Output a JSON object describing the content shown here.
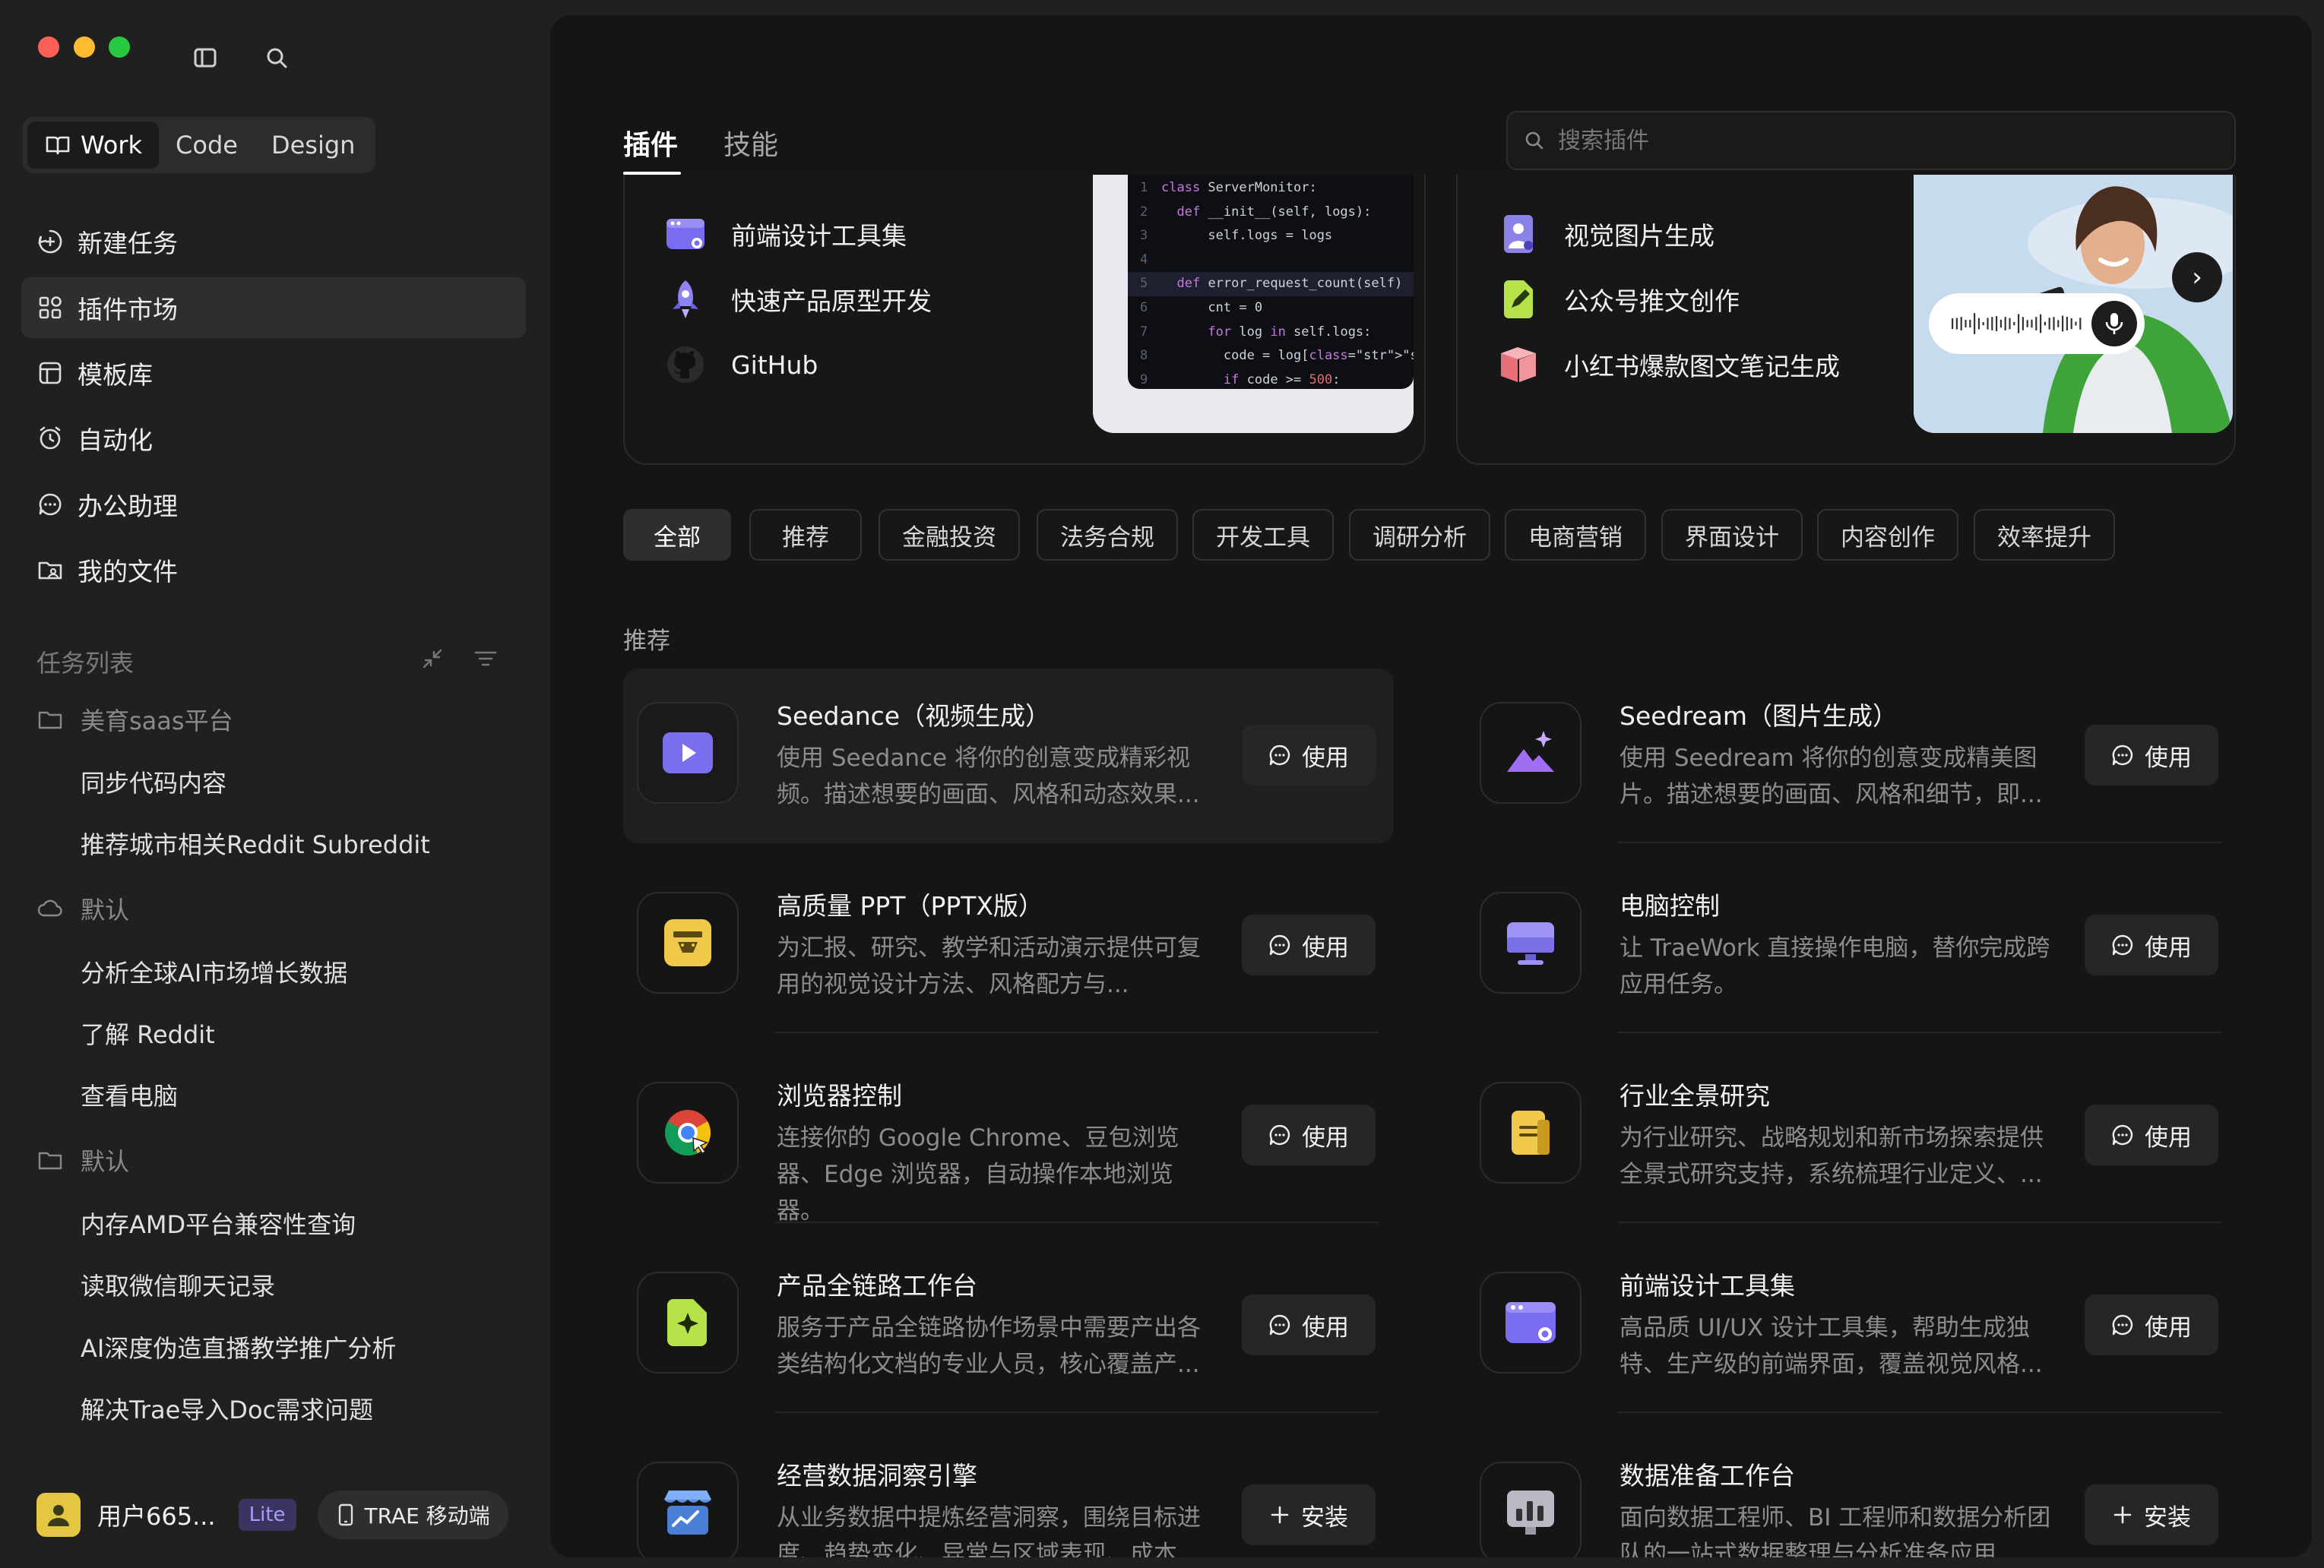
{
  "window": {
    "controls": [
      "close",
      "minimize",
      "maximize"
    ]
  },
  "sidebar": {
    "toggle_icon": "sidebar-toggle-icon",
    "search_icon": "search-icon",
    "modes": [
      {
        "label": "Work",
        "icon": "book-icon",
        "active": true
      },
      {
        "label": "Code",
        "active": false
      },
      {
        "label": "Design",
        "active": false
      }
    ],
    "nav": [
      {
        "label": "新建任务",
        "icon": "plus-circle-icon"
      },
      {
        "label": "插件市场",
        "icon": "plugin-grid-icon",
        "active": true
      },
      {
        "label": "模板库",
        "icon": "template-icon"
      },
      {
        "label": "自动化",
        "icon": "clock-icon"
      },
      {
        "label": "办公助理",
        "icon": "chat-icon"
      },
      {
        "label": "我的文件",
        "icon": "folder-user-icon"
      }
    ],
    "tasks_header": "任务列表",
    "groups": [
      {
        "name": "美育saas平台",
        "icon": "folder-icon",
        "tasks": [
          "同步代码内容",
          "推荐城市相关Reddit Subreddit"
        ]
      },
      {
        "name": "默认",
        "icon": "cloud-icon",
        "tasks": [
          "分析全球AI市场增长数据",
          "了解 Reddit",
          "查看电脑"
        ]
      },
      {
        "name": "默认",
        "icon": "folder-icon",
        "tasks": [
          "内存AMD平台兼容性查询",
          "读取微信聊天记录",
          "AI深度伪造直播教学推广分析",
          "解决Trae导入Doc需求问题"
        ]
      }
    ],
    "user": {
      "name": "用户665...",
      "plan": "Lite",
      "mobile_label": "TRAE 移动端"
    }
  },
  "main": {
    "tabs": [
      {
        "label": "插件",
        "active": true
      },
      {
        "label": "技能",
        "active": false
      }
    ],
    "search": {
      "placeholder": "搜索插件",
      "value": ""
    },
    "banner_left": {
      "items": [
        {
          "label": "前端设计工具集",
          "icon": "browser-window-icon"
        },
        {
          "label": "快速产品原型开发",
          "icon": "rocket-icon"
        },
        {
          "label": "GitHub",
          "icon": "github-icon"
        }
      ],
      "code_lines": [
        {
          "n": "1",
          "text": "class ServerMonitor:"
        },
        {
          "n": "2",
          "text": "  def __init__(self, logs):"
        },
        {
          "n": "3",
          "text": "      self.logs = logs"
        },
        {
          "n": "4",
          "text": ""
        },
        {
          "n": "5",
          "text": "  def error_request_count(self)"
        },
        {
          "n": "6",
          "text": "      cnt = 0"
        },
        {
          "n": "7",
          "text": "      for log in self.logs:"
        },
        {
          "n": "8",
          "text": "        code = log[\"status_cod"
        },
        {
          "n": "9",
          "text": "        if code >= 500:"
        }
      ]
    },
    "banner_right": {
      "items": [
        {
          "label": "视觉图片生成",
          "icon": "image-gen-icon"
        },
        {
          "label": "公众号推文创作",
          "icon": "document-edit-icon"
        },
        {
          "label": "小红书爆款图文笔记生成",
          "icon": "open-book-icon"
        }
      ]
    },
    "chips": [
      "全部",
      "推荐",
      "金融投资",
      "法务合规",
      "开发工具",
      "调研分析",
      "电商营销",
      "界面设计",
      "内容创作",
      "效率提升"
    ],
    "active_chip": "全部",
    "section_title": "推荐",
    "plugins": [
      {
        "title": "Seedance（视频生成）",
        "desc": "使用 Seedance 将你的创意变成精彩视频。描述想要的画面、风格和动态效果...",
        "action": "使用",
        "icon": "video-play-icon"
      },
      {
        "title": "Seedream（图片生成）",
        "desc": "使用 Seedream 将你的创意变成精美图片。描述想要的画面、风格和细节，即...",
        "action": "使用",
        "icon": "mountain-image-icon"
      },
      {
        "title": "高质量 PPT（PPTX版）",
        "desc": "为汇报、研究、教学和活动演示提供可复用的视觉设计方法、风格配方与...",
        "action": "使用",
        "icon": "presentation-icon"
      },
      {
        "title": "电脑控制",
        "desc": "让 TraeWork 直接操作电脑，替你完成跨应用任务。",
        "action": "使用",
        "icon": "monitor-icon"
      },
      {
        "title": "浏览器控制",
        "desc": "连接你的 Google Chrome、豆包浏览器、Edge 浏览器，自动操作本地浏览器。",
        "action": "使用",
        "icon": "chrome-icon"
      },
      {
        "title": "行业全景研究",
        "desc": "为行业研究、战略规划和新市场探索提供全景式研究支持，系统梳理行业定义、...",
        "action": "使用",
        "icon": "research-doc-icon"
      },
      {
        "title": "产品全链路工作台",
        "desc": "服务于产品全链路协作场景中需要产出各类结构化文档的专业人员，核心覆盖产...",
        "action": "使用",
        "icon": "sparkle-doc-icon"
      },
      {
        "title": "前端设计工具集",
        "desc": "高品质 UI/UX 设计工具集，帮助生成独特、生产级的前端界面，覆盖视觉风格...",
        "action": "使用",
        "icon": "browser-window-icon"
      },
      {
        "title": "经营数据洞察引擎",
        "desc": "从业务数据中提炼经营洞察，围绕目标进度、趋势变化、异常与区域表现、成本...",
        "action": "安装",
        "icon": "store-chart-icon"
      },
      {
        "title": "数据准备工作台",
        "desc": "面向数据工程师、BI 工程师和数据分析团队的一站式数据整理与分析准备应用...",
        "action": "安装",
        "icon": "bar-chart-icon"
      }
    ]
  }
}
